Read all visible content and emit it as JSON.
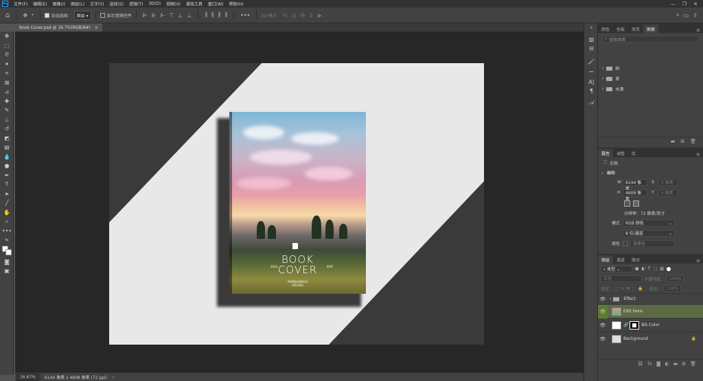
{
  "app": {
    "logo": "Ps"
  },
  "menu": [
    "文件(F)",
    "编辑(E)",
    "图像(I)",
    "图层(L)",
    "文字(Y)",
    "选择(S)",
    "滤镜(T)",
    "3D(D)",
    "视图(V)",
    "增效工具",
    "窗口(W)",
    "帮助(H)"
  ],
  "options": {
    "auto_select_label": "自动选择：",
    "auto_select_target": "图层",
    "show_transform_label": "显示变换控件",
    "mode_3d_label": "3D 模式："
  },
  "doc_tab": {
    "title": "Book Cover.psd @ 16.7%(RGB/8#)",
    "close": "×"
  },
  "status": {
    "zoom": "16.67%",
    "size": "6144 像素 x 4608 像素 (72 ppi)",
    "arrow": "›"
  },
  "cover": {
    "title_line1": "BOOK",
    "title_line2": "COVER",
    "small_left": "2024",
    "small_right": "EDIT",
    "subtitle": "RAINSHOWSUI\nHOUSES"
  },
  "libraries_panel": {
    "tabs": [
      "颜色",
      "色板",
      "渐变",
      "图案"
    ],
    "active_tab": "图案",
    "search_placeholder": "搜索图案",
    "items": [
      "树",
      "草",
      "水滴"
    ]
  },
  "properties_panel": {
    "tabs": [
      "属性",
      "调整",
      "库"
    ],
    "doc_label": "文档",
    "section": "画布",
    "w_label": "W",
    "w_value": "6144 像素",
    "x_label": "X",
    "x_placeholder": "0 像素",
    "h_label": "H",
    "h_value": "4608 像素",
    "y_label": "Y",
    "y_placeholder": "0 像素",
    "resolution": "分辨率：72 像素/英寸",
    "mode_label": "模式",
    "mode_value": "RGB 颜色",
    "depth_value": "8 位/通道",
    "fill_label": "填色",
    "fill_value": "背景色"
  },
  "layers_panel": {
    "tabs": [
      "图层",
      "通道",
      "路径"
    ],
    "filter_label": "类型",
    "blend_mode": "正常",
    "opacity_label": "不透明度：",
    "opacity_value": "100%",
    "lock_label": "锁定：",
    "fill_label": "填充：",
    "fill_value": "100%",
    "layers": [
      {
        "name": "Effect"
      },
      {
        "name": "Edit Here"
      },
      {
        "name": "BG Color"
      },
      {
        "name": "Background"
      }
    ]
  },
  "colors": {
    "selected_layer_highlight": "#5d6b45",
    "eye_highlight": "#5c7d2e",
    "accent": "#31a8ff"
  }
}
